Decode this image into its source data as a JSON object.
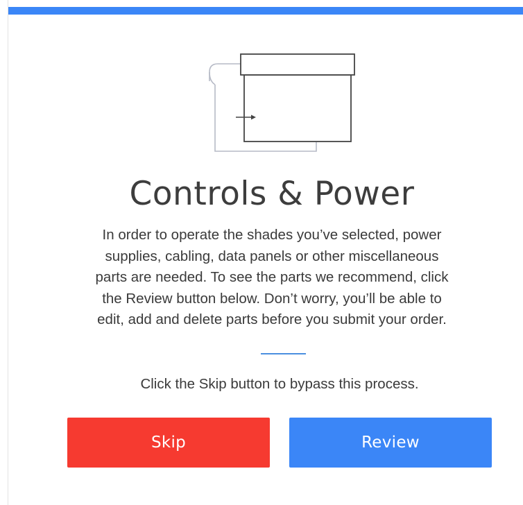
{
  "colors": {
    "accent": "#3b86f7",
    "skip_button": "#f63a30",
    "review_button": "#3b86f7",
    "divider": "#4a8fe0"
  },
  "illustration": {
    "icon": "shade-controls-icon"
  },
  "title": "Controls & Power",
  "description_lines": [
    "In order to operate the shades you’ve selected, power",
    "supplies, cabling, data panels or other miscellaneous",
    "parts are needed. To see the parts we recommend, click",
    "the Review button below. Don’t worry, you’ll be able to",
    "edit, add and delete parts before you submit your order."
  ],
  "skip_note": "Click the Skip button to bypass this process.",
  "buttons": {
    "skip_label": "Skip",
    "review_label": "Review"
  }
}
